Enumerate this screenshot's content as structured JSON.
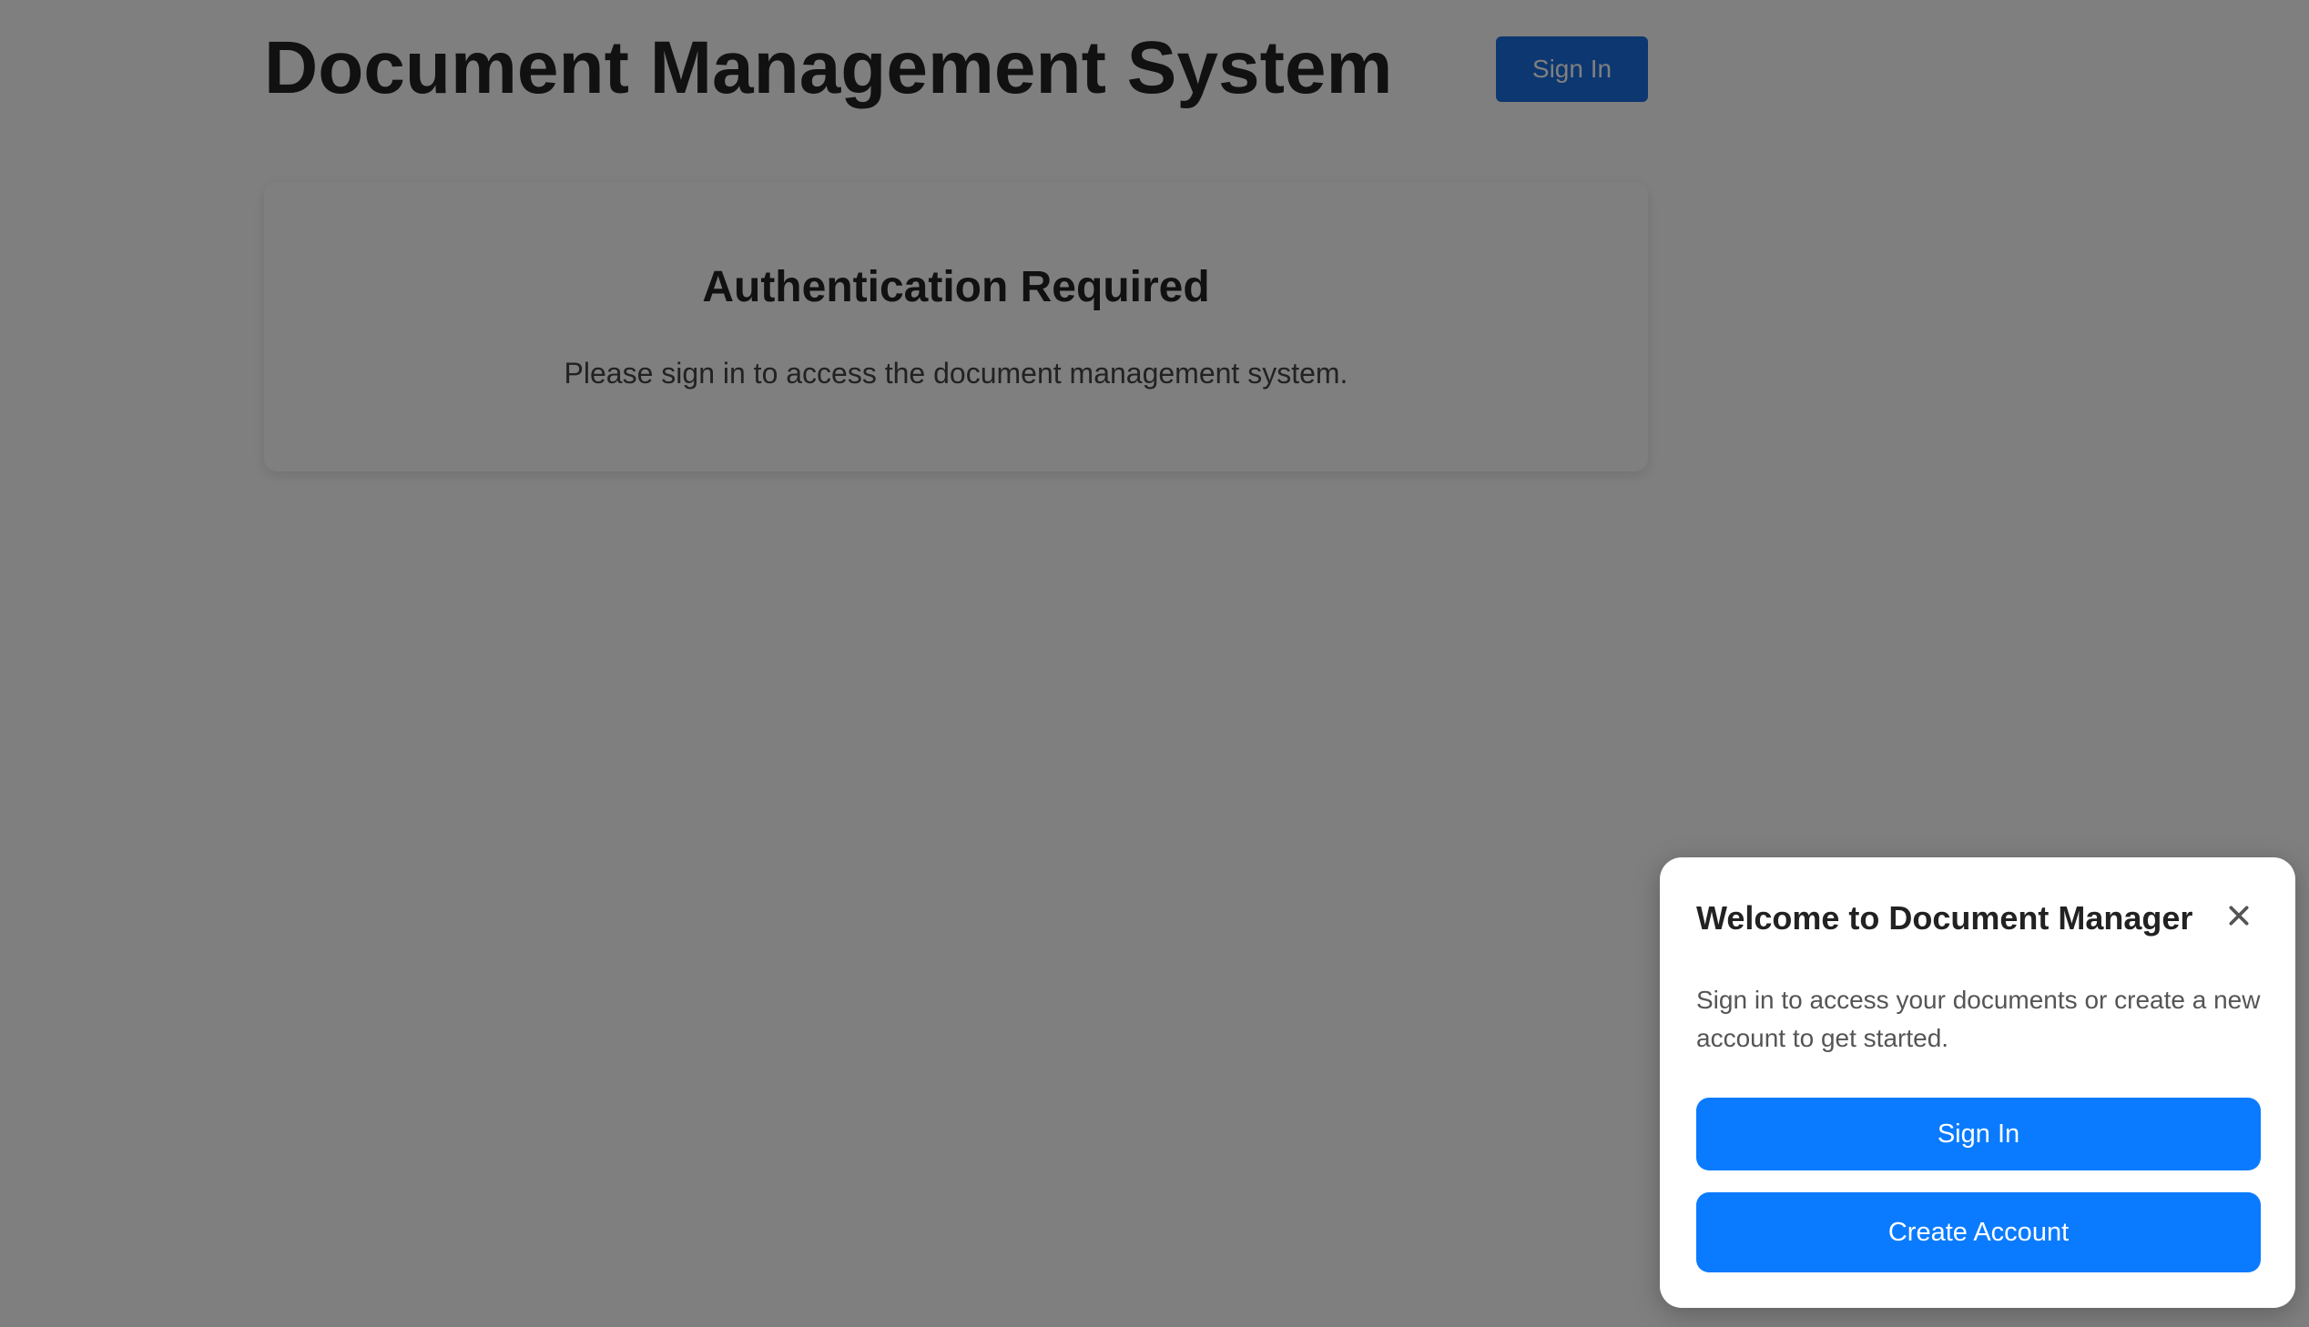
{
  "header": {
    "title": "Document Management System",
    "signin_label": "Sign In"
  },
  "auth_card": {
    "title": "Authentication Required",
    "message": "Please sign in to access the document management system."
  },
  "popup": {
    "title": "Welcome to Document Manager",
    "close_icon": "close-icon",
    "message": "Sign in to access your documents or create a new account to get started.",
    "signin_label": "Sign In",
    "create_account_label": "Create Account"
  },
  "colors": {
    "primary": "#0a7bff",
    "overlay": "rgba(0,0,0,0.5)",
    "text_dark": "#222222"
  }
}
